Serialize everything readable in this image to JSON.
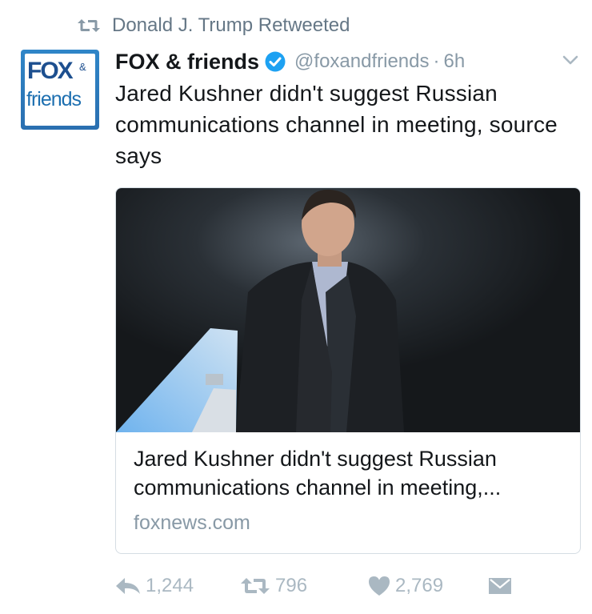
{
  "retweet_context": {
    "icon": "retweet-icon",
    "label": "Donald J. Trump Retweeted"
  },
  "tweet": {
    "author_name": "FOX & friends",
    "verified": true,
    "handle": "@foxandfriends",
    "separator": "·",
    "timestamp": "6h",
    "text": "Jared Kushner didn't suggest Russian communications channel in meeting, source says",
    "avatar": {
      "logo_top": "FOX",
      "logo_amp": "&",
      "logo_bottom": "friends"
    }
  },
  "card": {
    "title": "Jared Kushner didn't suggest Russian communications channel in meeting,...",
    "domain": "foxnews.com"
  },
  "actions": {
    "reply_count": "1,244",
    "retweet_count": "796",
    "like_count": "2,769"
  },
  "colors": {
    "text": "#14171a",
    "muted": "#8899a6",
    "icon_muted": "#aab8c2",
    "verified": "#1da1f2",
    "brand_blue": "#1d4f8f"
  }
}
